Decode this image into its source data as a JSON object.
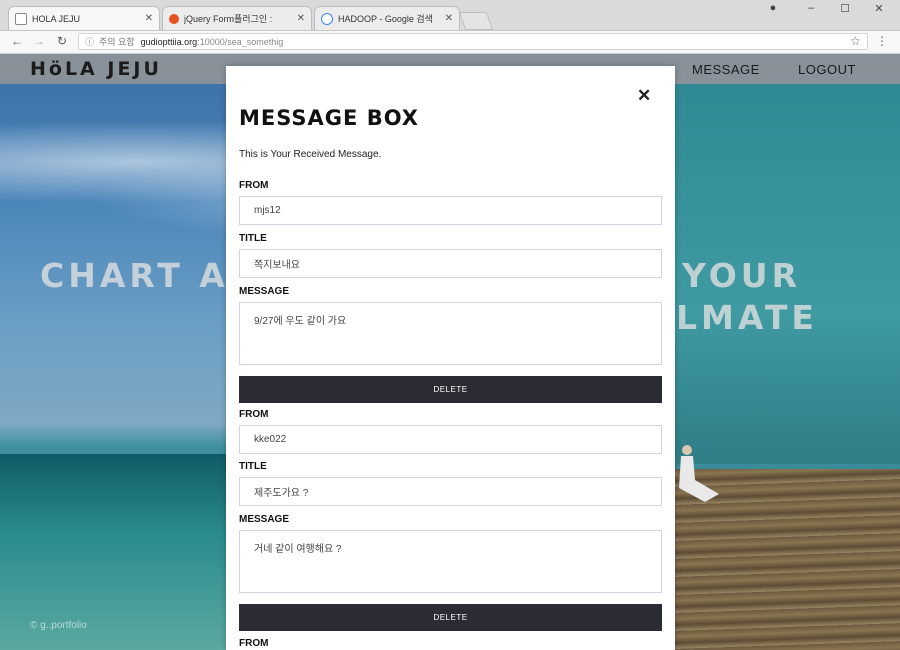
{
  "browser": {
    "tabs": [
      {
        "title": "HOLA JEJU",
        "active": true
      },
      {
        "title": "jQuery Form플러그인 :",
        "active": false
      },
      {
        "title": "HADOOP - Google 검색",
        "active": false
      }
    ],
    "address": {
      "security": "주의 요함",
      "host": "gudiopttiia.org",
      "path": ":10000/sea_somethig"
    },
    "window_controls": [
      "profile-icon",
      "minimize-icon",
      "maximize-icon",
      "close-icon"
    ]
  },
  "site": {
    "brand": "HöLA JEJU",
    "nav": {
      "message": "MESSAGE",
      "logout": "LOGOUT"
    },
    "hero_left": "CHART A",
    "hero_right_1": "YOUR",
    "hero_right_2": "LMATE",
    "footnote": "© g..portfolio"
  },
  "modal": {
    "title": "MESSAGE BOX",
    "subtitle": "This is Your Received Message.",
    "close_symbol": "✕",
    "labels": {
      "from": "FROM",
      "title": "TITLE",
      "message": "MESSAGE"
    },
    "delete_label": "DELETE",
    "messages": [
      {
        "from": "mjs12",
        "title": "쪽지보내요",
        "message": "9/27에 우도 같이 가요"
      },
      {
        "from": "kke022",
        "title": "제주도가요 ?",
        "message": "거네 같이 여행해요 ?"
      }
    ]
  }
}
